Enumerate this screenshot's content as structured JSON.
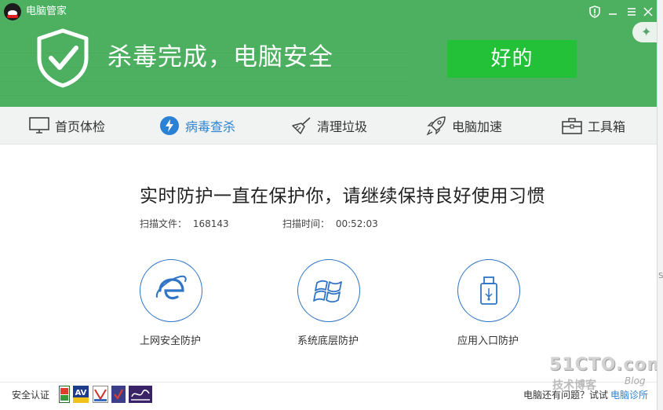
{
  "window": {
    "title": "电脑管家",
    "controls": [
      "shield-icon",
      "minimize-icon",
      "menu-icon",
      "close-icon"
    ]
  },
  "colors": {
    "header_green": "#4db061",
    "button_green": "#22c138",
    "accent_blue": "#2b82d4",
    "circle_blue": "#2f74c6"
  },
  "banner": {
    "status": "杀毒完成，电脑安全",
    "ok_button": "好的"
  },
  "nav": {
    "items": [
      {
        "label": "首页体检",
        "icon": "monitor-icon"
      },
      {
        "label": "病毒查杀",
        "icon": "lightning-icon",
        "active": true
      },
      {
        "label": "清理垃圾",
        "icon": "broom-icon"
      },
      {
        "label": "电脑加速",
        "icon": "rocket-icon"
      },
      {
        "label": "工具箱",
        "icon": "toolbox-icon"
      }
    ]
  },
  "main": {
    "headline": "实时防护一直在保护你，请继续保持良好使用习惯",
    "scanned_files_label": "扫描文件：",
    "scanned_files_value": "168143",
    "scan_time_label": "扫描时间：",
    "scan_time_value": "00:52:03",
    "protections": [
      {
        "label": "上网安全防护",
        "icon": "ie-browser-icon"
      },
      {
        "label": "系统底层防护",
        "icon": "windows-icon"
      },
      {
        "label": "应用入口防护",
        "icon": "usb-drive-icon"
      }
    ]
  },
  "footer": {
    "cert_label": "安全认证",
    "feedback": "电脑还有问题？试试",
    "diagnosis_link": "电脑诊所"
  },
  "watermark": {
    "main": "51CTO.com",
    "sub": "技术博客",
    "blog": "Blog"
  }
}
